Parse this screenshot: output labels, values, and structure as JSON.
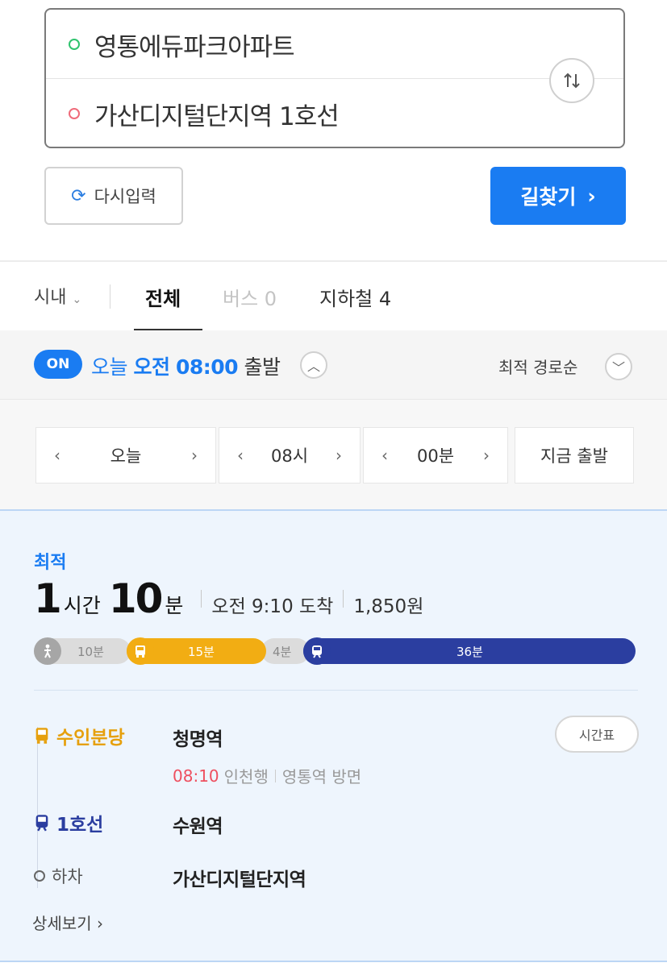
{
  "search": {
    "origin": "영통에듀파크아파트",
    "destination": "가산디지털단지역 1호선",
    "swap_icon": "swap-vertical-icon"
  },
  "actions": {
    "reset_label": "다시입력",
    "find_label": "길찾기",
    "find_arrow": "›"
  },
  "tabs": {
    "region": "시내",
    "all": "전체",
    "bus": "버스 0",
    "subway": "지하철 4",
    "active": "전체"
  },
  "time": {
    "toggle": "ON",
    "day": "오늘",
    "ampm": "오전",
    "clock": "08:00",
    "suffix": "출발",
    "sort": "최적 경로순",
    "pickers": {
      "day": "오늘",
      "hour": "08시",
      "minute": "00분",
      "now": "지금 출발"
    }
  },
  "result": {
    "badge": "최적",
    "hours": "1",
    "hours_unit": "시간",
    "minutes": "10",
    "minutes_unit": "분",
    "arrival": "오전 9:10 도착",
    "fare": "1,850원",
    "segments": [
      {
        "type": "walk",
        "label": "10분",
        "minutes": 10
      },
      {
        "type": "bus",
        "label": "15분",
        "minutes": 15
      },
      {
        "type": "walk",
        "label": "4분",
        "minutes": 4
      },
      {
        "type": "subway",
        "label": "36분",
        "minutes": 36
      }
    ],
    "steps": {
      "bus_line": "수인분당",
      "bus_station": "청명역",
      "bus_time": "08:10",
      "bus_direction": "인천행",
      "bus_towards": "영통역 방면",
      "timetable": "시간표",
      "subway_line": "1호선",
      "subway_station": "수원역",
      "off_label": "하차",
      "off_station": "가산디지털단지역"
    },
    "detail": "상세보기 ›"
  },
  "colors": {
    "accent": "#1a7cf2",
    "bus": "#f2ad13",
    "subway": "#2b3ea0",
    "time_red": "#ee4f5f"
  }
}
